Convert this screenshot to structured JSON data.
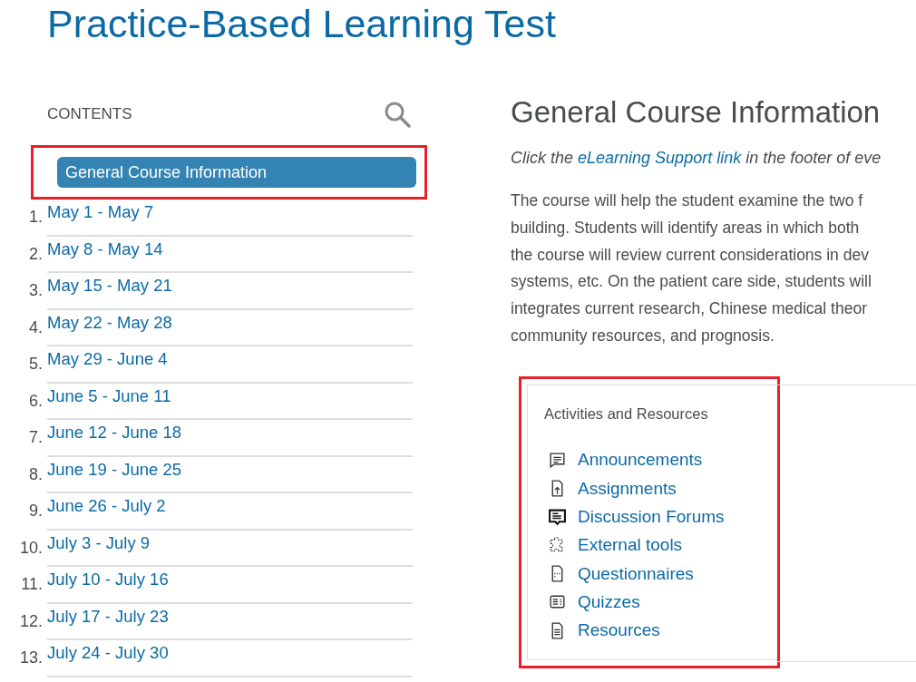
{
  "page_title": "Practice-Based Learning Test",
  "contents": {
    "heading": "CONTENTS",
    "items": [
      {
        "label": "General Course Information",
        "selected": true,
        "highlighted": true
      },
      {
        "number": "1.",
        "label": "May 1 - May 7",
        "selected": false,
        "highlighted": false
      },
      {
        "number": "2.",
        "label": "May 8 - May 14",
        "selected": false,
        "highlighted": false
      },
      {
        "number": "3.",
        "label": "May 15 - May 21",
        "selected": false,
        "highlighted": false
      },
      {
        "number": "4.",
        "label": "May 22 - May 28",
        "selected": false,
        "highlighted": false
      },
      {
        "number": "5.",
        "label": "May 29 - June 4",
        "selected": false,
        "highlighted": false
      },
      {
        "number": "6.",
        "label": "June 5 - June 11",
        "selected": false,
        "highlighted": false
      },
      {
        "number": "7.",
        "label": "June 12 - June 18",
        "selected": false,
        "highlighted": false
      },
      {
        "number": "8.",
        "label": "June 19 - June 25",
        "selected": false,
        "highlighted": false
      },
      {
        "number": "9.",
        "label": "June 26 - July 2",
        "selected": false,
        "highlighted": false
      },
      {
        "number": "10.",
        "label": "July 3 - July 9",
        "selected": false,
        "highlighted": false
      },
      {
        "number": "11.",
        "label": "July 10 - July 16",
        "selected": false,
        "highlighted": false
      },
      {
        "number": "12.",
        "label": "July 17 - July 23",
        "selected": false,
        "highlighted": false
      },
      {
        "number": "13.",
        "label": "July 24 - July 30",
        "selected": false,
        "highlighted": false
      }
    ]
  },
  "main": {
    "heading": "General Course Information",
    "note": {
      "before": "Click the ",
      "link": "eLearning Support link",
      "after": " in the footer of eve"
    },
    "paragraph_lines": [
      "The course will help the student examine the two f",
      "building. Students will identify areas in which both",
      "the course will review current considerations in dev",
      "systems, etc. On the patient care side, students will",
      "integrates current research, Chinese medical theor",
      "community resources, and prognosis."
    ],
    "activities": {
      "heading": "Activities and Resources",
      "highlighted": true,
      "items": [
        {
          "kind": "announcements",
          "label": "Announcements"
        },
        {
          "kind": "assignments",
          "label": "Assignments"
        },
        {
          "kind": "discussions",
          "label": "Discussion Forums"
        },
        {
          "kind": "tools",
          "label": "External tools"
        },
        {
          "kind": "questionnaires",
          "label": "Questionnaires"
        },
        {
          "kind": "quizzes",
          "label": "Quizzes"
        },
        {
          "kind": "resources",
          "label": "Resources"
        }
      ]
    }
  }
}
